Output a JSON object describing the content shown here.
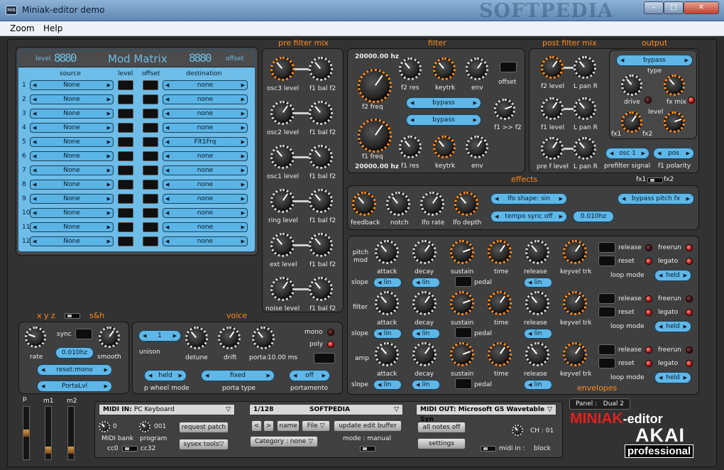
{
  "window": {
    "title": "Miniak-editor demo",
    "icon_text": "MIN",
    "watermark": "SOFTPEDIA",
    "controls": [
      "minimize",
      "maximize",
      "close"
    ]
  },
  "menu": [
    "Zoom",
    "Help"
  ],
  "sections": {
    "pre_filter_mix": "pre filter mix",
    "filter": "filter",
    "post_filter_mix": "post filter mix",
    "output": "output",
    "effects": "effects",
    "voice": "voice",
    "xyz": "x y z",
    "sh": "s&h",
    "envelopes": "envelopes"
  },
  "mod_matrix": {
    "title": "Mod Matrix",
    "level_label": "level",
    "offset_label": "offset",
    "level_readout": "8880",
    "offset_readout": "8880",
    "headers": [
      "source",
      "level",
      "offset",
      "destination"
    ],
    "rows": [
      {
        "n": "1",
        "source": "None",
        "dest": "none"
      },
      {
        "n": "2",
        "source": "None",
        "dest": "none"
      },
      {
        "n": "3",
        "source": "None",
        "dest": "none"
      },
      {
        "n": "4",
        "source": "None",
        "dest": "none"
      },
      {
        "n": "5",
        "source": "None",
        "dest": "Flt1Frq"
      },
      {
        "n": "6",
        "source": "None",
        "dest": "none"
      },
      {
        "n": "7",
        "source": "None",
        "dest": "none"
      },
      {
        "n": "8",
        "source": "None",
        "dest": "none"
      },
      {
        "n": "9",
        "source": "None",
        "dest": "none"
      },
      {
        "n": "10",
        "source": "None",
        "dest": "none"
      },
      {
        "n": "11",
        "source": "None",
        "dest": "none"
      },
      {
        "n": "12",
        "source": "None",
        "dest": "none"
      }
    ]
  },
  "prefilter": {
    "labels": [
      "osc3 level",
      "f1 bal f2",
      "osc2 level",
      "f1 bal f2",
      "osc1 level",
      "f1 bal f2",
      "ring level",
      "f1 bal f2",
      "ext level",
      "f1 bal f2",
      "noise level",
      "f1 bal f2"
    ]
  },
  "filter": {
    "f2_hz": "20000.00 hz",
    "f1_hz": "20000.00 hz",
    "f2_freq": "f2 freq",
    "f1_freq": "f1 freq",
    "f2_res": "f2 res",
    "keytrk": "keytrk",
    "env": "env",
    "offset": "offset",
    "f1_res": "f1 res",
    "f1f2": "f1 >> f2",
    "bypass1": "bypass",
    "bypass2": "bypass"
  },
  "postfilter": {
    "labels": [
      "f2 level",
      "L pan R",
      "f1 level",
      "L pan R",
      "pre f level",
      "L pan R"
    ],
    "prefilter_signal": "prefilter signal",
    "f1_polarity": "f1 polarity",
    "osc_sel": "osc 1",
    "pos_sel": "pos"
  },
  "output": {
    "bypass": "bypass",
    "type": "type",
    "drive": "drive",
    "fx_mix": "fx mix",
    "level": "level",
    "fx1": "fx1",
    "fx2": "fx2"
  },
  "effects": {
    "fx1": "fx1",
    "fx2": "fx2",
    "feedback": "feedback",
    "notch": "notch",
    "lfo_rate": "lfo rate",
    "lfo_depth": "lfo depth",
    "lfo_shape": "lfo shape: sin",
    "tempo_sync": "tempo sync off",
    "rate_value": "0.010hz",
    "bypass_pitch": "bypass pitch fx"
  },
  "envelopes": {
    "rows": [
      {
        "name": "pitch mod",
        "attack": "attack",
        "decay": "decay",
        "sustain": "sustain",
        "time": "time",
        "release": "release",
        "keyvel": "keyvel trk",
        "slope": "slope",
        "pedal": "pedal",
        "lin": "lin",
        "loop": "loop mode",
        "held": "held",
        "release_l": "release",
        "reset": "reset",
        "freerun": "freerun",
        "legato": "legato"
      },
      {
        "name": "filter"
      },
      {
        "name": "amp"
      }
    ]
  },
  "xyz": {
    "sync": "sync",
    "rate": "rate",
    "smooth": "smooth",
    "rate_value": "0.010hz",
    "reset": "reset:mono",
    "porta": "PortaLvl"
  },
  "voice": {
    "unison_value": "1",
    "unison": "unison",
    "detune": "detune",
    "drift": "drift",
    "porta_label": "porta:",
    "porta_value": "10.00 ms",
    "mono": "mono",
    "poly": "poly",
    "held": "held",
    "pwheel": "p wheel mode",
    "fixed": "fixed",
    "porta_type": "porta type",
    "off": "off",
    "portamento": "portamento"
  },
  "bottom": {
    "faders": [
      "p",
      "m1",
      "m2"
    ],
    "midi_in": "MIDI IN:",
    "midi_in_val": "PC Keyboard",
    "bank_val": "0",
    "bank": "MIDI bank",
    "program_val": "001",
    "program": "program",
    "request": "request patch",
    "sysex": "sysex tools",
    "cc0": "cc0",
    "cc32": "cc32",
    "patch_num": "1/128",
    "patch_name": "SOFTPEDIA",
    "prev": "<",
    "next": ">",
    "name": "name",
    "file": "File",
    "update": "update edit buffer",
    "category": "Category : none",
    "mode": "mode : manual",
    "midi_out": "MIDI OUT:",
    "midi_out_val": "Microsoft GS Wavetable Syn",
    "notes_off": "all notes off",
    "settings": "settings",
    "ch": "CH : 01",
    "midi_in_block": "midi in :",
    "block": "block",
    "panel": "Panel :",
    "panel_val": "Dual 2",
    "brand": "MINIAK",
    "brand2": "-editor",
    "akai": "AKAI",
    "professional": "professional"
  }
}
